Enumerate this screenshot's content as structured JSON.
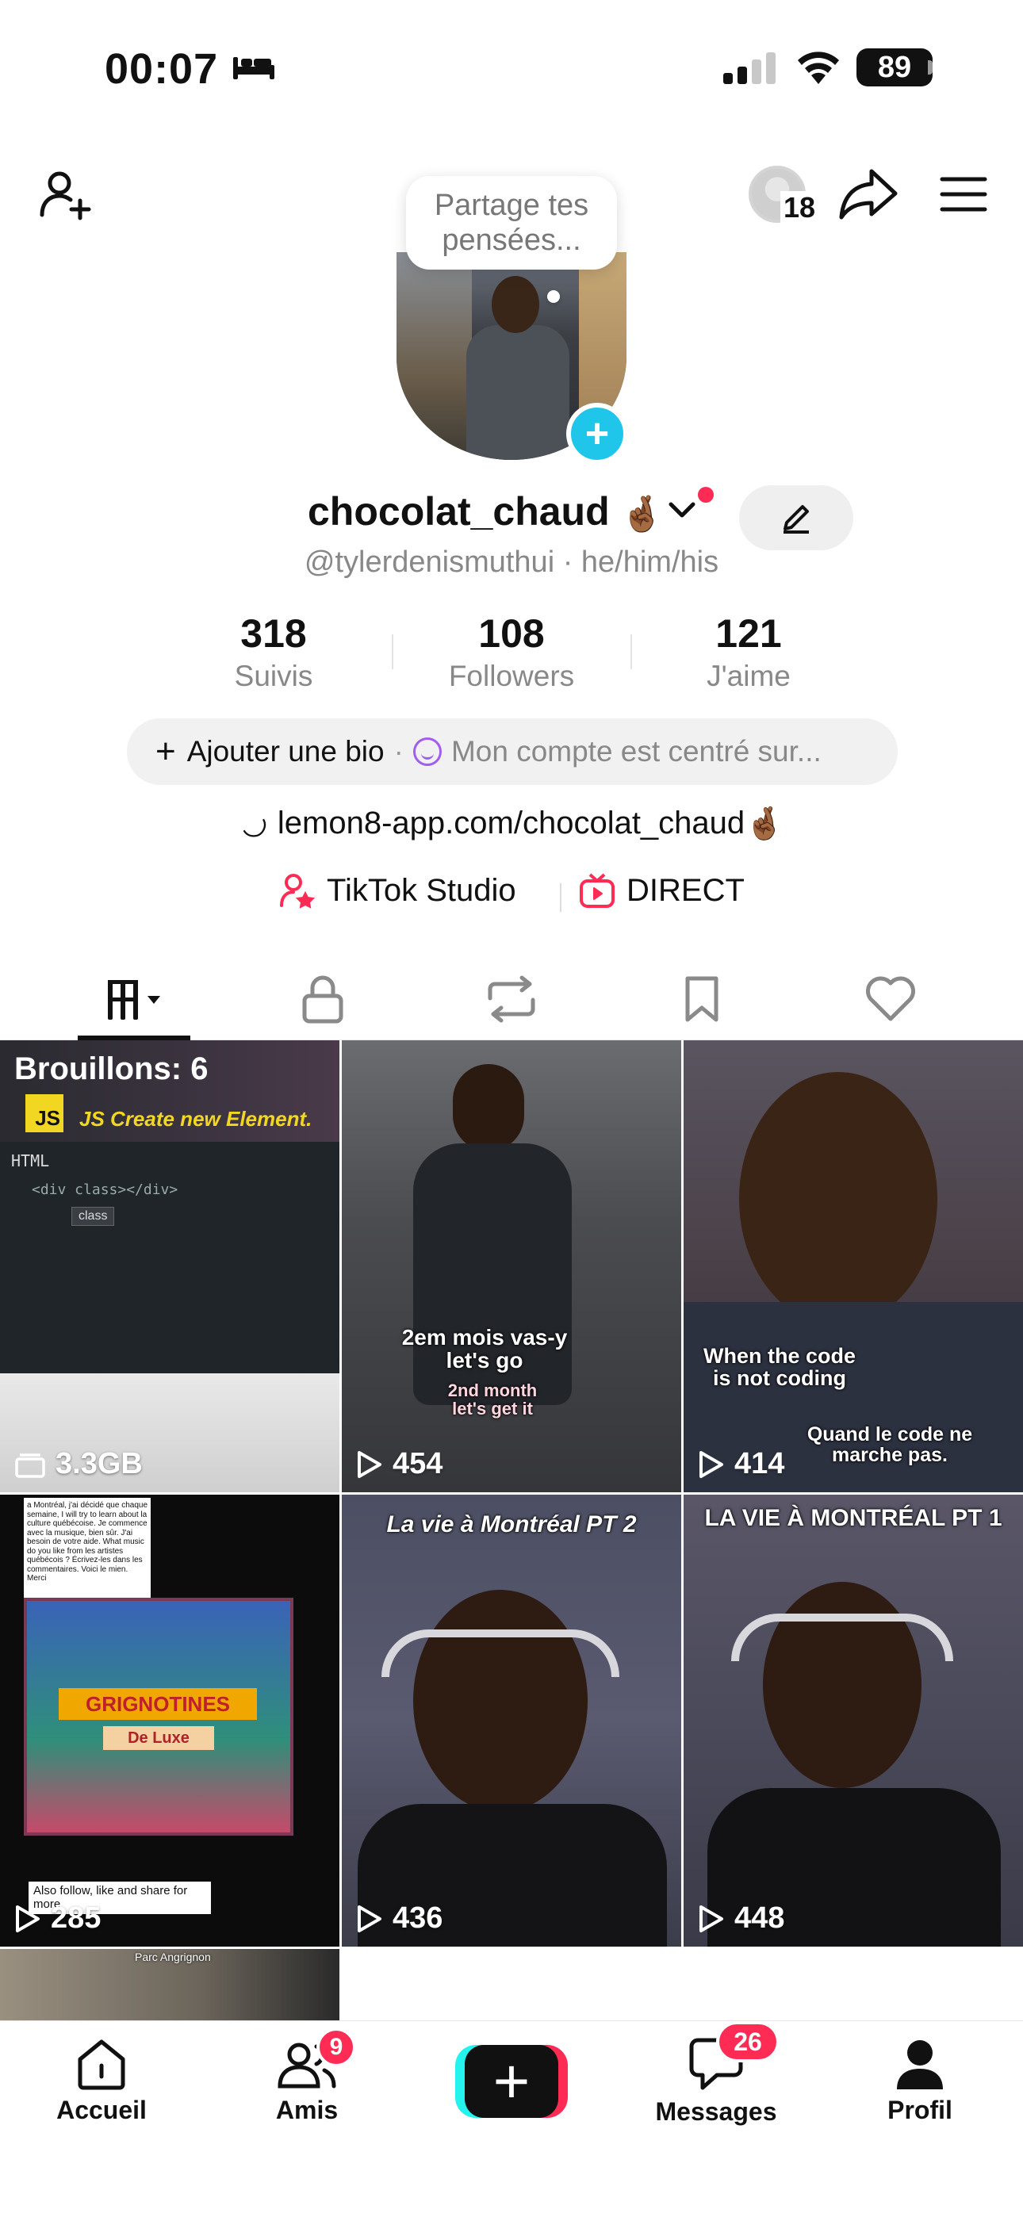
{
  "status_bar": {
    "time": "00:07",
    "battery": "89"
  },
  "top_bar": {
    "views_count": "18"
  },
  "bubble": {
    "text": "Partage tes pensées..."
  },
  "profile": {
    "username": "chocolat_chaud",
    "username_emoji": "🤞🏾",
    "handle": "@tylerdenismuthui · he/him/his",
    "stats": [
      {
        "value": "318",
        "label": "Suivis"
      },
      {
        "value": "108",
        "label": "Followers"
      },
      {
        "value": "121",
        "label": "J'aime"
      }
    ],
    "bio_add": "Ajouter une bio",
    "bio_desc": "Mon compte est centré sur...",
    "link": "lemon8-app.com/chocolat_chaud",
    "link_emoji": "🤞🏾",
    "tools": [
      {
        "label": "TikTok Studio"
      },
      {
        "label": "DIRECT"
      }
    ]
  },
  "tabs": [
    "videos",
    "private",
    "reposts",
    "saved",
    "liked"
  ],
  "grid": {
    "drafts_label": "Brouillons: 6",
    "drafts_size": "3.3GB",
    "drafts_js_text": "JS Create new Element.",
    "drafts_code_header": "HTML",
    "drafts_code_line": "<div class></div>",
    "drafts_code_tag": "class",
    "videos": [
      {
        "count": "454",
        "caption": "2em mois vas-y let's go",
        "caption2": "2nd month let's get it"
      },
      {
        "count": "414",
        "caption": "When the code is not coding",
        "caption2": "Quand le code ne marche pas."
      },
      {
        "count": "285",
        "caption": "a Montréal, j'ai décidé que chaque semaine, I will try to learn about la culture québécoise. Je commence avec la musique, bien sûr. J'ai besoin de votre aide. What music do you like from les artistes québécois ? Écrivez-les dans les commentaires. Voici le mien. Merci",
        "caption2": "Also follow, like and share for more",
        "album": "GRIGNOTINES",
        "album2": "De Luxe"
      },
      {
        "count": "436",
        "caption": "La vie à Montréal PT 2"
      },
      {
        "count": "448",
        "caption": "LA VIE À MONTRÉAL PT 1"
      }
    ],
    "partial_caption": "Parc Angrignon"
  },
  "bottom_nav": {
    "home": "Accueil",
    "friends": "Amis",
    "friends_badge": "9",
    "messages": "Messages",
    "messages_badge": "26",
    "profile": "Profil"
  },
  "colors": {
    "accent_red": "#fe2c55",
    "accent_cyan": "#25f4ee",
    "plus_blue": "#20c5ea"
  }
}
